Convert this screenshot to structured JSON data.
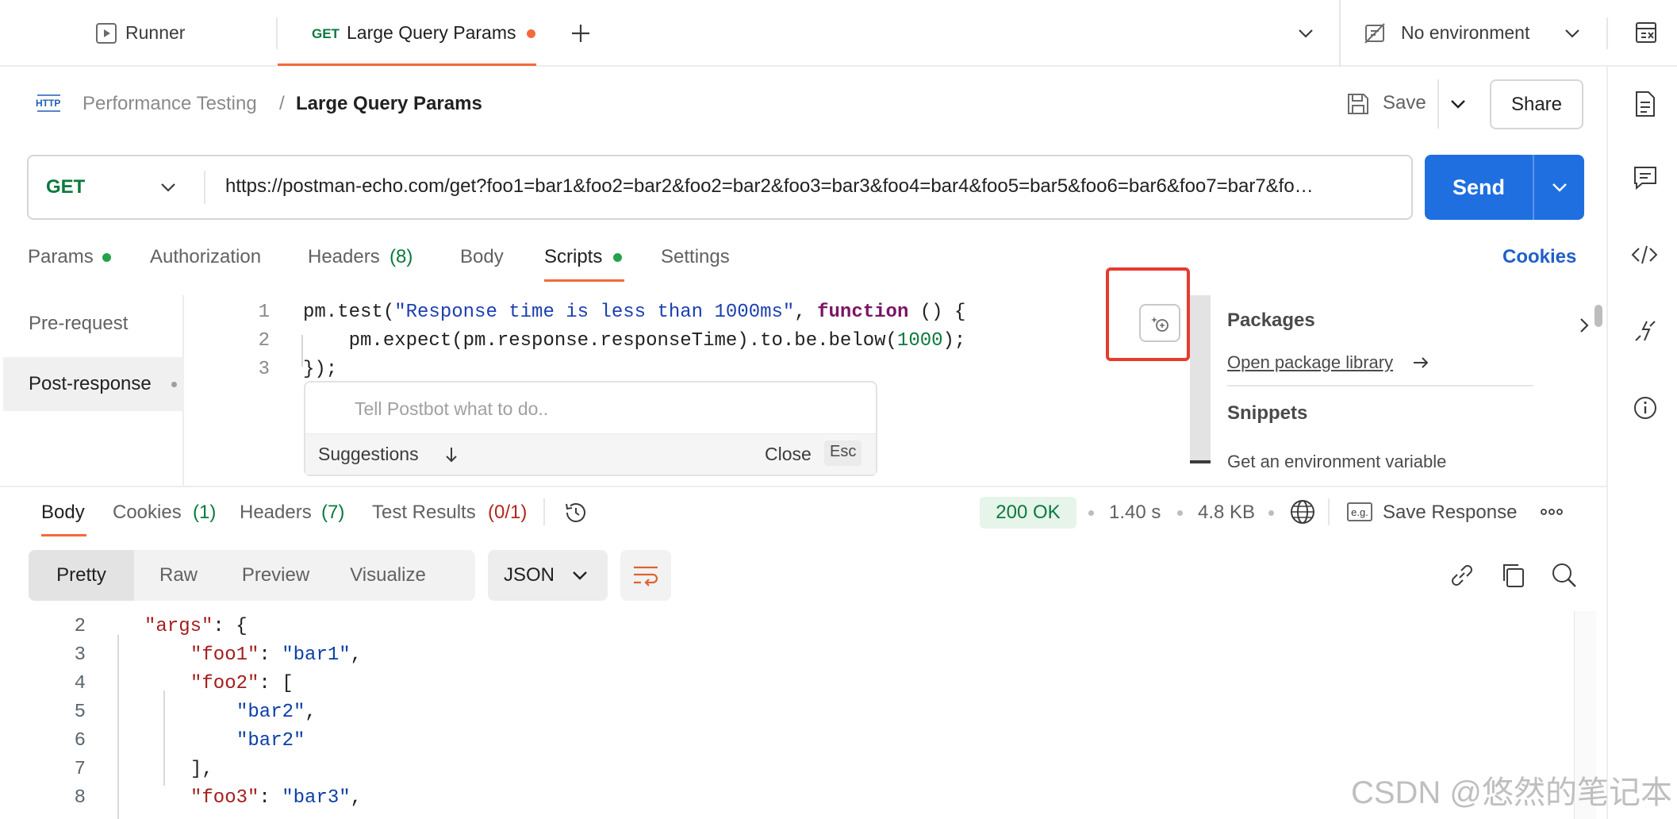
{
  "tabs": {
    "runner_label": "Runner",
    "active": {
      "method": "GET",
      "label": "Large Query Params"
    }
  },
  "environment": {
    "label": "No environment"
  },
  "breadcrumb": {
    "icon_text": "HTTP",
    "collection": "Performance Testing",
    "separator": "/",
    "request": "Large Query Params"
  },
  "actions": {
    "save": "Save",
    "share": "Share"
  },
  "request": {
    "method": "GET",
    "url": "https://postman-echo.com/get?foo1=bar1&foo2=bar2&foo2=bar2&foo3=bar3&foo4=bar4&foo5=bar5&foo6=bar6&foo7=bar7&fo…",
    "send": "Send"
  },
  "request_tabs": {
    "params": "Params",
    "authorization": "Authorization",
    "headers": "Headers",
    "headers_count": "(8)",
    "body": "Body",
    "scripts": "Scripts",
    "settings": "Settings",
    "cookies": "Cookies"
  },
  "scripts": {
    "pre_request": "Pre-request",
    "post_response": "Post-response",
    "code": [
      {
        "num": "1",
        "parts": [
          [
            "pm.test(",
            "plain"
          ],
          [
            "\"Response time is less than 1000ms\"",
            "str"
          ],
          [
            ", ",
            "plain"
          ],
          [
            "function",
            "kw"
          ],
          [
            " () {",
            "plain"
          ]
        ]
      },
      {
        "num": "2",
        "parts": [
          [
            "    pm.expect(pm.response.responseTime).to.be.below(",
            "plain"
          ],
          [
            "1000",
            "num"
          ],
          [
            ");",
            "plain"
          ]
        ]
      },
      {
        "num": "3",
        "parts": [
          [
            "});",
            "plain"
          ]
        ]
      }
    ]
  },
  "postbot": {
    "placeholder": "Tell Postbot what to do..",
    "suggestions": "Suggestions",
    "close": "Close",
    "esc": "Esc"
  },
  "side_panel": {
    "packages_title": "Packages",
    "open_library": "Open package library",
    "snippets_title": "Snippets",
    "snippet_item": "Get an environment variable"
  },
  "response": {
    "tabs": {
      "body": "Body",
      "cookies": "Cookies",
      "cookies_count": "(1)",
      "headers": "Headers",
      "headers_count": "(7)",
      "tests": "Test Results",
      "tests_count": "(0/1)"
    },
    "status": "200 OK",
    "time": "1.40 s",
    "size": "4.8 KB",
    "save_response": "Save Response",
    "eg_label": "e.g.",
    "view_modes": [
      "Pretty",
      "Raw",
      "Preview",
      "Visualize"
    ],
    "format": "JSON",
    "json_lines": [
      {
        "num": "2",
        "indent": 1,
        "parts": [
          [
            "\"args\"",
            "key"
          ],
          [
            ": {",
            "pun"
          ]
        ]
      },
      {
        "num": "3",
        "indent": 2,
        "parts": [
          [
            "\"foo1\"",
            "key"
          ],
          [
            ": ",
            "pun"
          ],
          [
            "\"bar1\"",
            "str"
          ],
          [
            ",",
            "pun"
          ]
        ]
      },
      {
        "num": "4",
        "indent": 2,
        "parts": [
          [
            "\"foo2\"",
            "key"
          ],
          [
            ": [",
            "pun"
          ]
        ]
      },
      {
        "num": "5",
        "indent": 3,
        "parts": [
          [
            "\"bar2\"",
            "str"
          ],
          [
            ",",
            "pun"
          ]
        ]
      },
      {
        "num": "6",
        "indent": 3,
        "parts": [
          [
            "\"bar2\"",
            "str"
          ]
        ]
      },
      {
        "num": "7",
        "indent": 2,
        "parts": [
          [
            "],",
            "pun"
          ]
        ]
      },
      {
        "num": "8",
        "indent": 2,
        "parts": [
          [
            "\"foo3\"",
            "key"
          ],
          [
            ": ",
            "pun"
          ],
          [
            "\"bar3\"",
            "str"
          ],
          [
            ",",
            "pun"
          ]
        ]
      }
    ]
  },
  "watermark": "CSDN @悠然的笔记本",
  "colors": {
    "accent": "#1f6fe0",
    "unsaved_dot": "#f26b3a",
    "status_green": "#0a7a3d",
    "highlight_box": "#e63b2e"
  }
}
